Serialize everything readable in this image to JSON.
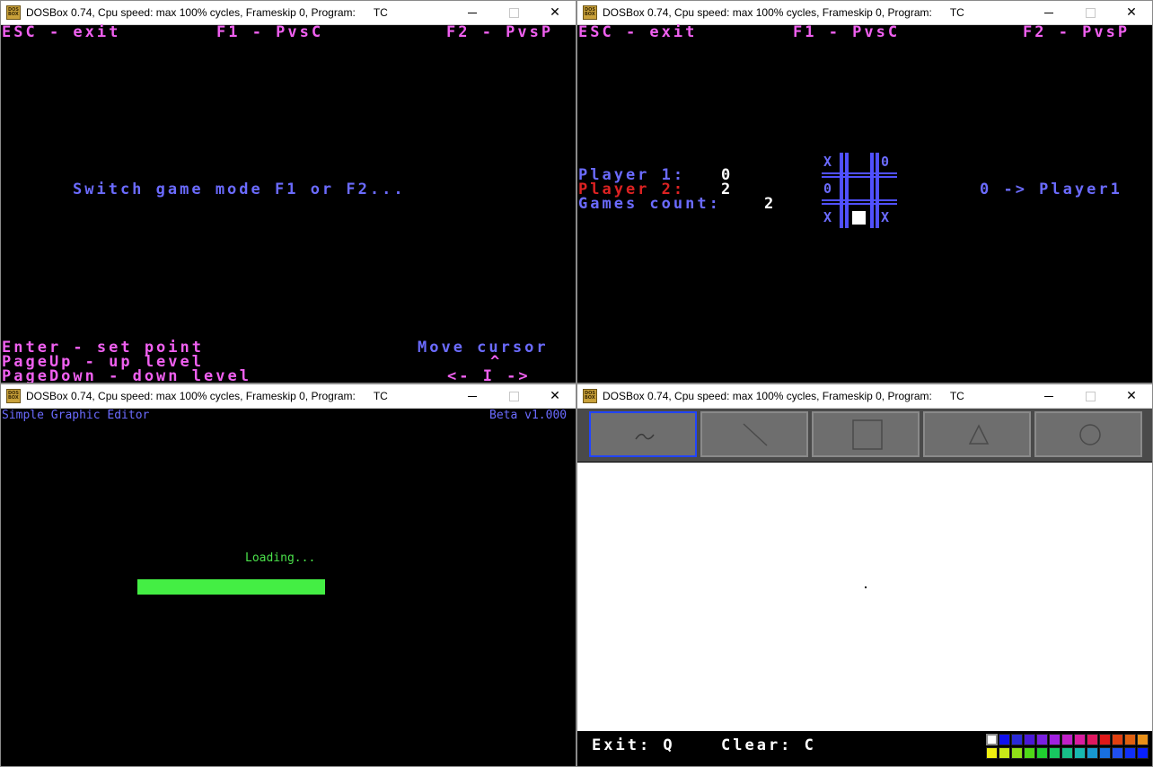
{
  "windows": {
    "title": "DOSBox 0.74, Cpu speed: max 100% cycles, Frameskip  0, Program:",
    "program": "TC",
    "icon_label": "DOS BOX",
    "controls": {
      "minimize": "—",
      "maximize": "☐",
      "close": "✕"
    }
  },
  "menu_screen": {
    "top_esc": "ESC - exit",
    "top_f1": "F1 - PvsC",
    "top_f2": "F2 - PvsP",
    "center": "Switch game mode F1 or F2...",
    "enter": "Enter - set point",
    "pageup": "PageUp - up level",
    "pagedown": "PageDown - down level",
    "move": "Move cursor",
    "caret": "^",
    "arrows": "<- I ->"
  },
  "game_screen": {
    "top_esc": "ESC - exit",
    "top_f1": "F1 - PvsC",
    "top_f2": "F2 - PvsP",
    "player1_label": "Player 1:",
    "player1_score": "0",
    "player2_label": "Player 2:",
    "player2_score": "2",
    "games_label": "Games count:",
    "games_count": "2",
    "turn": "0 -> Player1",
    "board": [
      [
        "X",
        "",
        "0"
      ],
      [
        "0",
        "",
        ""
      ],
      [
        "X",
        "cursor",
        "X"
      ]
    ]
  },
  "editor_screen": {
    "title": "Simple Graphic Editor",
    "version": "Beta v1.000",
    "loading_text": "Loading...",
    "progress": 1.0
  },
  "paint_screen": {
    "tools": [
      {
        "name": "freehand",
        "icon": "freehand-icon",
        "active": true
      },
      {
        "name": "line",
        "icon": "line-icon",
        "active": false
      },
      {
        "name": "rectangle",
        "icon": "rectangle-icon",
        "active": false
      },
      {
        "name": "triangle",
        "icon": "triangle-icon",
        "active": false
      },
      {
        "name": "circle",
        "icon": "circle-icon",
        "active": false
      }
    ],
    "exit_label": "Exit: Q",
    "clear_label": "Clear: C",
    "palette": [
      "#ffffff",
      "#1010ee",
      "#2a2ad8",
      "#4a18d8",
      "#7a20e0",
      "#a020e0",
      "#c020c8",
      "#d81ca0",
      "#e01860",
      "#e01818",
      "#e04010",
      "#e06010",
      "#e89018",
      "#f0f010",
      "#c8e818",
      "#90e018",
      "#50d818",
      "#20d030",
      "#18c860",
      "#18c088",
      "#18b8b0",
      "#1898d0",
      "#1870e0",
      "#2050f0",
      "#1030f8",
      "#0820ff"
    ],
    "accent": "#2244ff"
  }
}
